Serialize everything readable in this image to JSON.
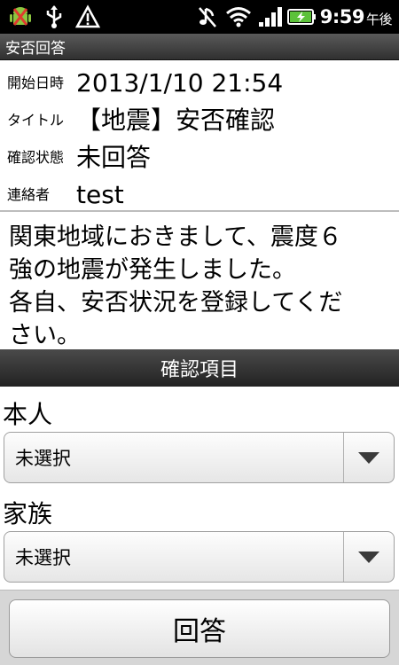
{
  "status_bar": {
    "time": "9:59",
    "ampm": "午後",
    "icons": [
      "android-debug-icon",
      "usb-icon",
      "warning-icon",
      "mute-icon",
      "wifi-icon",
      "signal-icon",
      "battery-charging-icon"
    ]
  },
  "app": {
    "title": "安否回答"
  },
  "info": {
    "start_label": "開始日時",
    "start_value": "2013/1/10 21:54",
    "title_label": "タイトル",
    "title_value": "【地震】安否確認",
    "status_label": "確認状態",
    "status_value": "未回答",
    "contact_label": "連絡者",
    "contact_value": "test"
  },
  "message": {
    "line1": "関東地域におきまして、震度６",
    "line2": "強の地震が発生しました。",
    "line3": "各自、安否状況を登録してくだ",
    "line4": "さい。"
  },
  "section": {
    "title": "確認項目"
  },
  "fields": {
    "self_label": "本人",
    "self_value": "未選択",
    "family_label": "家族",
    "family_value": "未選択"
  },
  "actions": {
    "answer_label": "回答"
  }
}
